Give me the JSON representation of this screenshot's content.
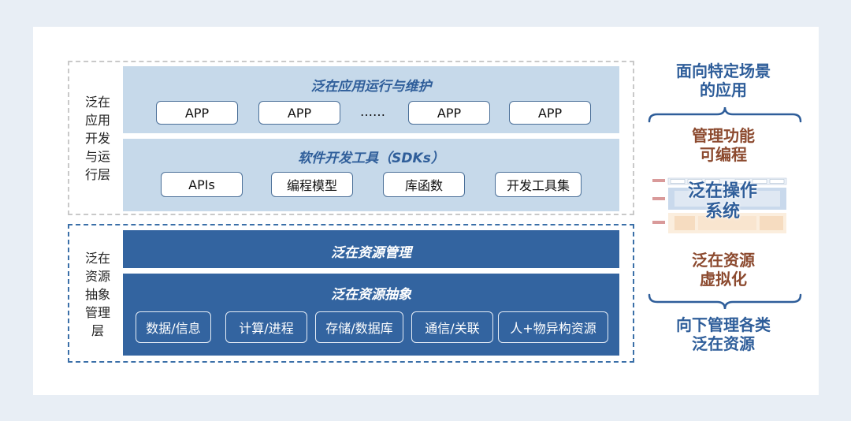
{
  "left_labels": {
    "top": [
      "泛在",
      "应用",
      "开发",
      "与运",
      "行层"
    ],
    "bottom": [
      "泛在",
      "资源",
      "抽象",
      "管理",
      "层"
    ]
  },
  "panels": {
    "app_ops": {
      "title": "泛在应用运行与维护",
      "items": [
        "APP",
        "APP",
        "……",
        "APP",
        "APP"
      ]
    },
    "sdk": {
      "title": "软件开发工具（SDKs）",
      "items": [
        "APIs",
        "编程模型",
        "库函数",
        "开发工具集"
      ]
    },
    "resource_mgmt": {
      "title": "泛在资源管理"
    },
    "resource_abstract": {
      "title": "泛在资源抽象",
      "items": [
        "数据/信息",
        "计算/进程",
        "存储/数据库",
        "通信/关联",
        "人+物异构资源"
      ]
    }
  },
  "right": {
    "top": [
      "面向特定场景",
      "的应用"
    ],
    "mid_top": [
      "管理功能",
      "可编程"
    ],
    "os_title": [
      "泛在操作",
      "系统"
    ],
    "mid_bottom": [
      "泛在资源",
      "虚拟化"
    ],
    "bottom": [
      "向下管理各类",
      "泛在资源"
    ]
  },
  "colors": {
    "light_panel": "#c6d9ea",
    "dark_panel": "#3364a0",
    "accent_blue": "#2f5e9a",
    "accent_brown": "#8c4a2f"
  }
}
